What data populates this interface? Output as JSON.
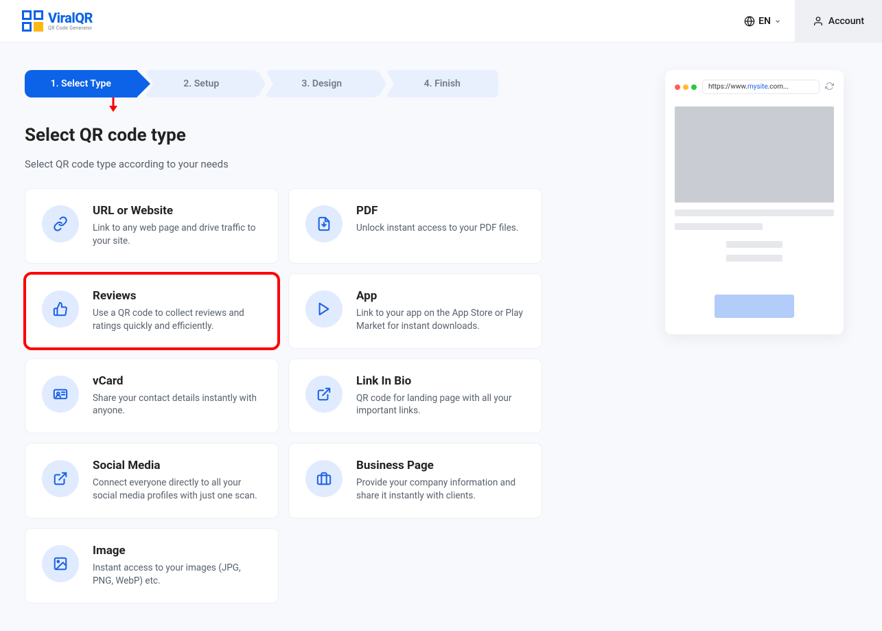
{
  "header": {
    "brand_main": "ViralQR",
    "brand_sub": "QR Code Generator",
    "lang_label": "EN",
    "account_label": "Account"
  },
  "stepper": {
    "steps": [
      {
        "label": "1. Select Type",
        "active": true
      },
      {
        "label": "2. Setup",
        "active": false
      },
      {
        "label": "3. Design",
        "active": false
      },
      {
        "label": "4. Finish",
        "active": false
      }
    ]
  },
  "page": {
    "heading": "Select QR code type",
    "subheading": "Select QR code type according to your needs"
  },
  "cards": [
    {
      "icon": "link-icon",
      "title": "URL or Website",
      "desc": "Link to any web page and drive traffic to your site.",
      "highlight": false
    },
    {
      "icon": "pdf-icon",
      "title": "PDF",
      "desc": "Unlock instant access to your PDF files.",
      "highlight": false
    },
    {
      "icon": "thumbs-up-icon",
      "title": "Reviews",
      "desc": "Use a QR code to collect reviews and ratings quickly and efficiently.",
      "highlight": true
    },
    {
      "icon": "play-icon",
      "title": "App",
      "desc": "Link to your app on the App Store or Play Market for instant downloads.",
      "highlight": false
    },
    {
      "icon": "vcard-icon",
      "title": "vCard",
      "desc": "Share your contact details instantly with anyone.",
      "highlight": false
    },
    {
      "icon": "external-link-icon",
      "title": "Link In Bio",
      "desc": "QR code for landing page with all your important links.",
      "highlight": false
    },
    {
      "icon": "share-icon",
      "title": "Social Media",
      "desc": "Connect everyone directly to all your social media profiles with just one scan.",
      "highlight": false
    },
    {
      "icon": "briefcase-icon",
      "title": "Business Page",
      "desc": "Provide your company information and share it instantly with clients.",
      "highlight": false
    },
    {
      "icon": "image-icon",
      "title": "Image",
      "desc": "Instant access to your images (JPG, PNG, WebP) etc.",
      "highlight": false
    }
  ],
  "preview": {
    "url_prefix": "https://www.",
    "url_highlight": "mysite",
    "url_suffix": ".com..."
  }
}
